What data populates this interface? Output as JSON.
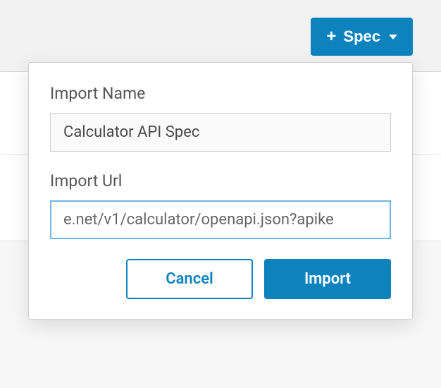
{
  "header": {
    "spec_button_label": "Spec"
  },
  "popover": {
    "import_name": {
      "label": "Import Name",
      "value": "Calculator API Spec"
    },
    "import_url": {
      "label": "Import Url",
      "value": "e.net/v1/calculator/openapi.json?apike"
    },
    "buttons": {
      "cancel": "Cancel",
      "import": "Import"
    }
  },
  "colors": {
    "primary": "#0d83be"
  }
}
